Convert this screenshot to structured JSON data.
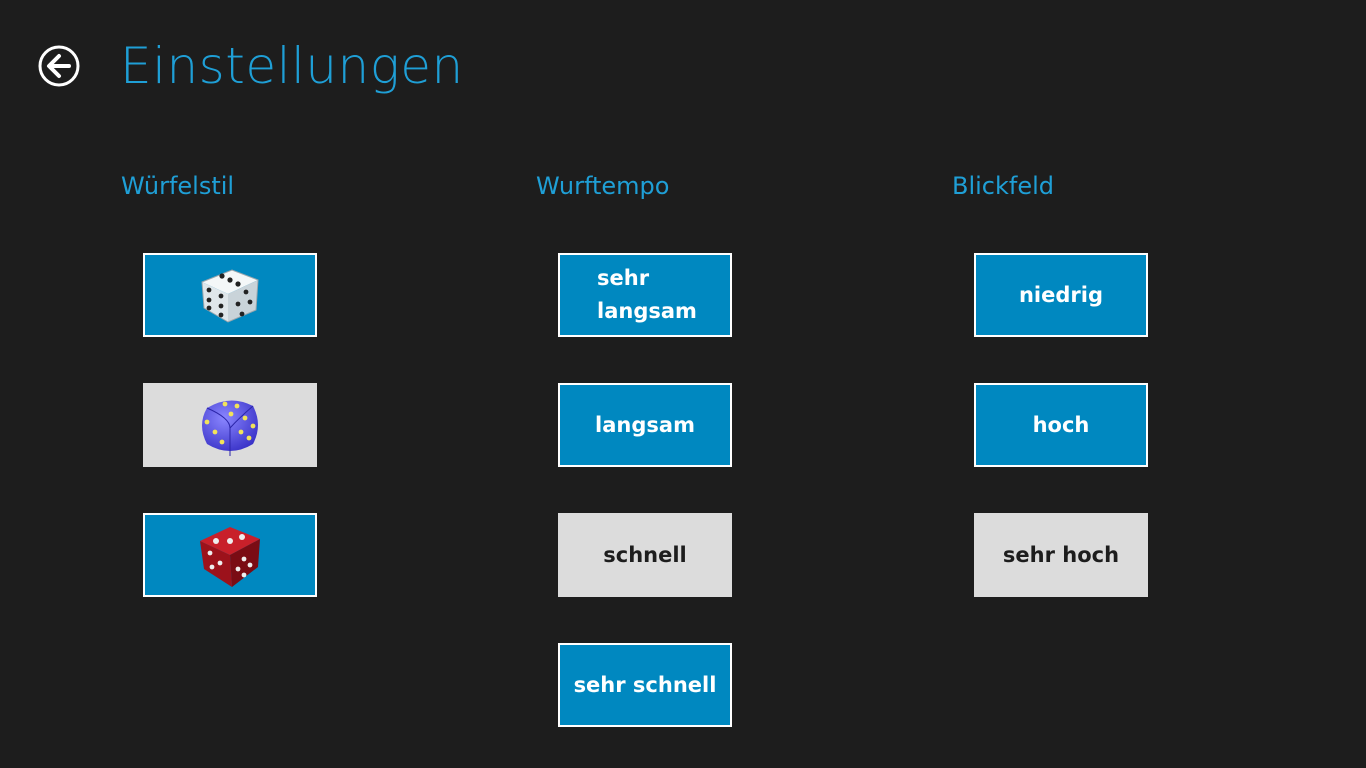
{
  "header": {
    "title": "Einstellungen",
    "back_icon": "back-arrow-circle-icon"
  },
  "sections": {
    "dice_style": {
      "heading": "Würfelstil",
      "options": [
        {
          "icon": "white-die-icon",
          "selected": false
        },
        {
          "icon": "blue-die-icon",
          "selected": true
        },
        {
          "icon": "red-die-icon",
          "selected": false
        }
      ]
    },
    "throw_speed": {
      "heading": "Wurftempo",
      "options": [
        {
          "label": "sehr langsam",
          "selected": false
        },
        {
          "label": "langsam",
          "selected": false
        },
        {
          "label": "schnell",
          "selected": true
        },
        {
          "label": "sehr schnell",
          "selected": false
        }
      ]
    },
    "field_of_view": {
      "heading": "Blickfeld",
      "options": [
        {
          "label": "niedrig",
          "selected": false
        },
        {
          "label": "hoch",
          "selected": false
        },
        {
          "label": "sehr hoch",
          "selected": true
        }
      ]
    }
  },
  "colors": {
    "background": "#1d1d1d",
    "accent": "#1f9fd6",
    "button": "#0088c0",
    "button_selected": "#dcdcdc"
  }
}
